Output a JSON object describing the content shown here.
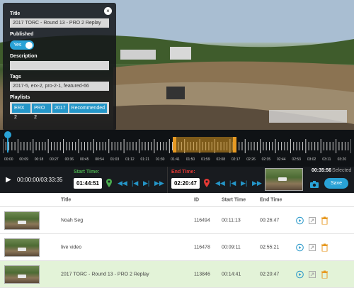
{
  "editor": {
    "title_label": "Title",
    "title_value": "2017 TORC - Round 13 - PRO 2 Replay",
    "published_label": "Published",
    "published_value": "Yes",
    "description_label": "Description",
    "description_value": "",
    "tags_label": "Tags",
    "tags_value": "2017-5, erx-2, pro-2-1, featured-66",
    "playlists_label": "Playlists",
    "playlists": [
      "ERX 2",
      "PRO 2",
      "2017",
      "Recommended"
    ],
    "close_symbol": "×"
  },
  "timeline": {
    "tick_labels": [
      "00:00",
      "00:09",
      "00:18",
      "00:27",
      "00:36",
      "00:45",
      "00:54",
      "01:03",
      "01:12",
      "01:21",
      "01:30",
      "01:41",
      "01:50",
      "01:59",
      "02:08",
      "02:17",
      "02:26",
      "02:35",
      "02:44",
      "02:53",
      "03:02",
      "03:11",
      "03:20"
    ]
  },
  "controls": {
    "elapsed": "00:00:00/03:33:35",
    "start_label": "Start Time:",
    "start_value": "01:44:51",
    "end_label": "End Time:",
    "end_value": "02:20:47",
    "selected_duration": "00:35:56",
    "selected_label": "Selected",
    "save_label": "Save",
    "accent_color": "#29a2d6",
    "start_color": "#4caf50",
    "end_color": "#e53935"
  },
  "table": {
    "headers": [
      "Title",
      "ID",
      "Start Time",
      "End Time"
    ],
    "rows": [
      {
        "title": "Noah Seg",
        "id": "116494",
        "start": "00:11:13",
        "end": "00:26:47",
        "highlight": false
      },
      {
        "title": "live video",
        "id": "116478",
        "start": "00:09:11",
        "end": "02:55:21",
        "highlight": false
      },
      {
        "title": "2017 TORC - Round 13 - PRO 2 Replay",
        "id": "113846",
        "start": "00:14:41",
        "end": "02:20:47",
        "highlight": true
      }
    ]
  }
}
